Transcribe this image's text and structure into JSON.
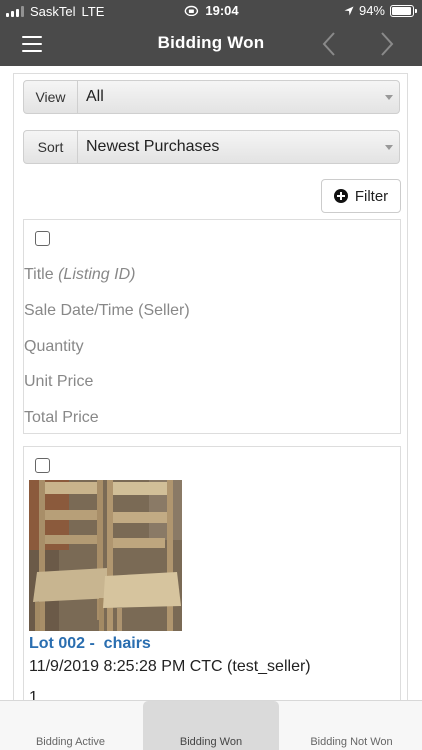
{
  "status_bar": {
    "carrier": "SaskTel",
    "network": "LTE",
    "time": "19:04",
    "battery": "94%",
    "battery_level": 0.94
  },
  "header": {
    "title": "Bidding Won"
  },
  "view_select": {
    "label": "View",
    "value": "All"
  },
  "sort_select": {
    "label": "Sort",
    "value": "Newest Purchases"
  },
  "filter_button": {
    "label": "Filter"
  },
  "columns": {
    "title": "Title",
    "listing_id": "(Listing ID)",
    "sale_date": "Sale Date/Time (Seller)",
    "quantity": "Quantity",
    "unit_price": "Unit Price",
    "total_price": "Total Price"
  },
  "items": [
    {
      "lot": "Lot 002 -  chairs",
      "sale_date": "11/9/2019 8:25:28 PM CTC (test_seller)",
      "quantity": "1"
    }
  ],
  "tabs": [
    {
      "label": "Bidding Active",
      "active": false
    },
    {
      "label": "Bidding Won",
      "active": true
    },
    {
      "label": "Bidding Not Won",
      "active": false
    }
  ],
  "colors": {
    "header_bg": "#4a4a4a",
    "link": "#2a6eb0"
  }
}
